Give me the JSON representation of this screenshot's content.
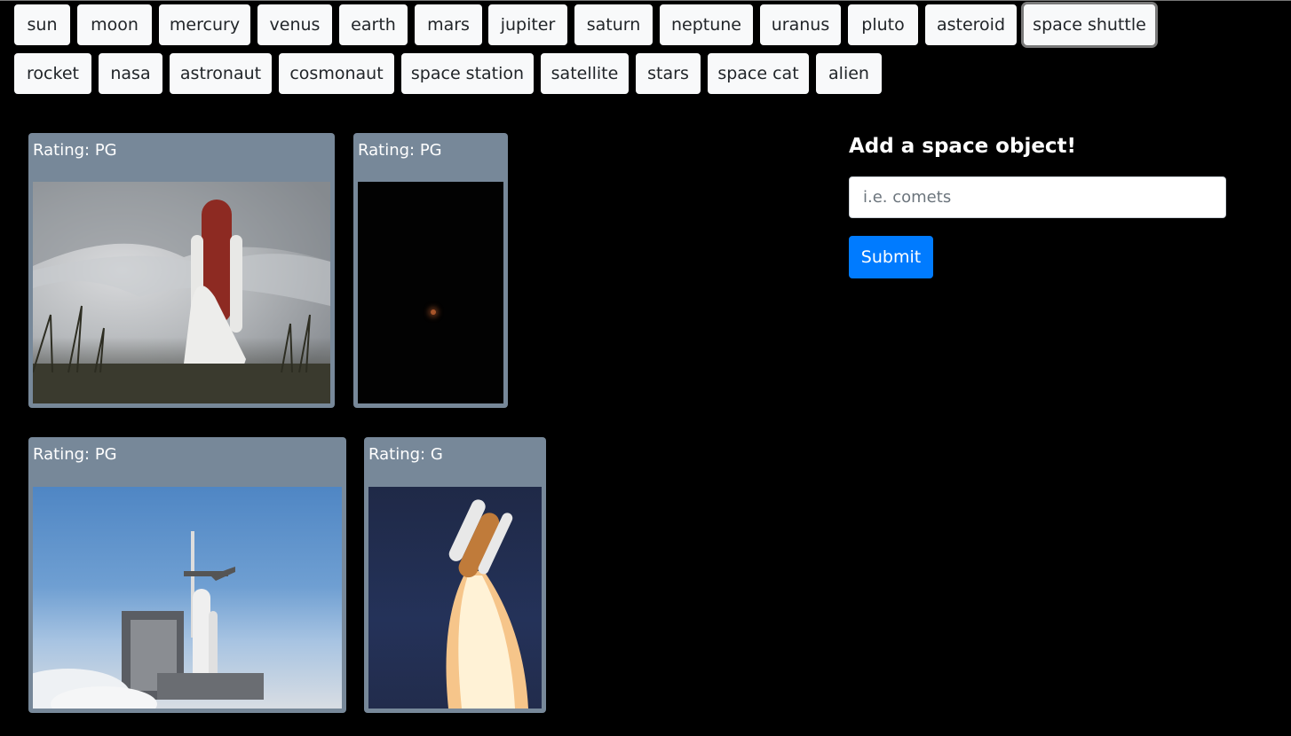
{
  "topics": [
    "sun",
    "moon",
    "mercury",
    "venus",
    "earth",
    "mars",
    "jupiter",
    "saturn",
    "neptune",
    "uranus",
    "pluto",
    "asteroid",
    "space shuttle",
    "rocket",
    "nasa",
    "astronaut",
    "cosmonaut",
    "space station",
    "satellite",
    "stars",
    "space cat",
    "alien"
  ],
  "focused_topic": "space shuttle",
  "gifs": [
    {
      "rating": "Rating: PG",
      "scene": "shuttle-on-pad-cloudy"
    },
    {
      "rating": "Rating: PG",
      "scene": "night-launch"
    },
    {
      "rating": "Rating: PG",
      "scene": "launch-pad-blue-sky"
    },
    {
      "rating": "Rating: G",
      "scene": "liftoff"
    }
  ],
  "form": {
    "title": "Add a space object!",
    "placeholder": "i.e. comets",
    "value": "",
    "submit_label": "Submit"
  },
  "colors": {
    "background": "#000000",
    "card": "#778899",
    "button_bg": "#f8f9fa",
    "submit": "#007bff"
  }
}
